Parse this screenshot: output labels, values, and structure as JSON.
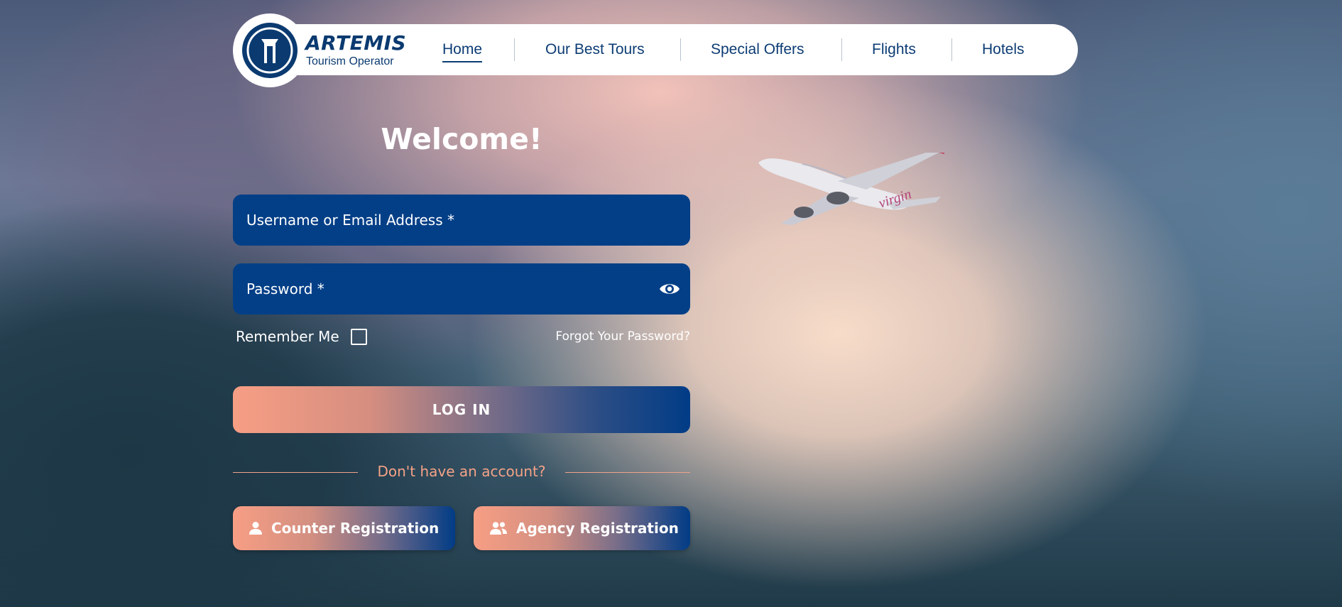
{
  "brand": {
    "name": "ARTEMIS",
    "tagline": "Tourism Operator"
  },
  "nav": {
    "items": [
      {
        "label": "Home",
        "active": true
      },
      {
        "label": "Our Best Tours"
      },
      {
        "label": "Special Offers"
      },
      {
        "label": "Flights"
      },
      {
        "label": "Hotels"
      }
    ]
  },
  "form": {
    "title": "Welcome!",
    "username_placeholder": "Username or Email Address *",
    "password_placeholder": "Password *",
    "remember_label": "Remember Me",
    "remember_checked": false,
    "forgot_link": "Forgot Your Password?",
    "login_label": "LOG IN",
    "no_account_text": "Don't have an account?"
  },
  "registration": {
    "counter_label": "Counter Registration",
    "agency_label": "Agency Registration"
  },
  "colors": {
    "primary": "#023f87",
    "accent": "#f79e84"
  },
  "icons": {
    "password_toggle": "eye-icon",
    "counter": "person-icon",
    "agency": "people-icon"
  }
}
